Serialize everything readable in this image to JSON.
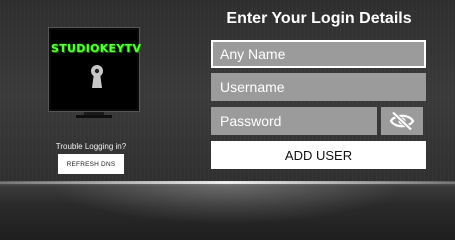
{
  "logo": {
    "brand_text": "STUDIOKEYTV"
  },
  "help": {
    "trouble_text": "Trouble Logging in?",
    "refresh_label": "REFRESH DNS"
  },
  "form": {
    "title": "Enter Your Login Details",
    "name_placeholder": "Any Name",
    "username_placeholder": "Username",
    "password_placeholder": "Password",
    "password_toggle_icon": "eye-slash-icon",
    "submit_label": "ADD USER"
  },
  "colors": {
    "brand_green": "#59ff3a",
    "field_bg": "#9b9b9b",
    "focus_border": "#ffffff"
  }
}
